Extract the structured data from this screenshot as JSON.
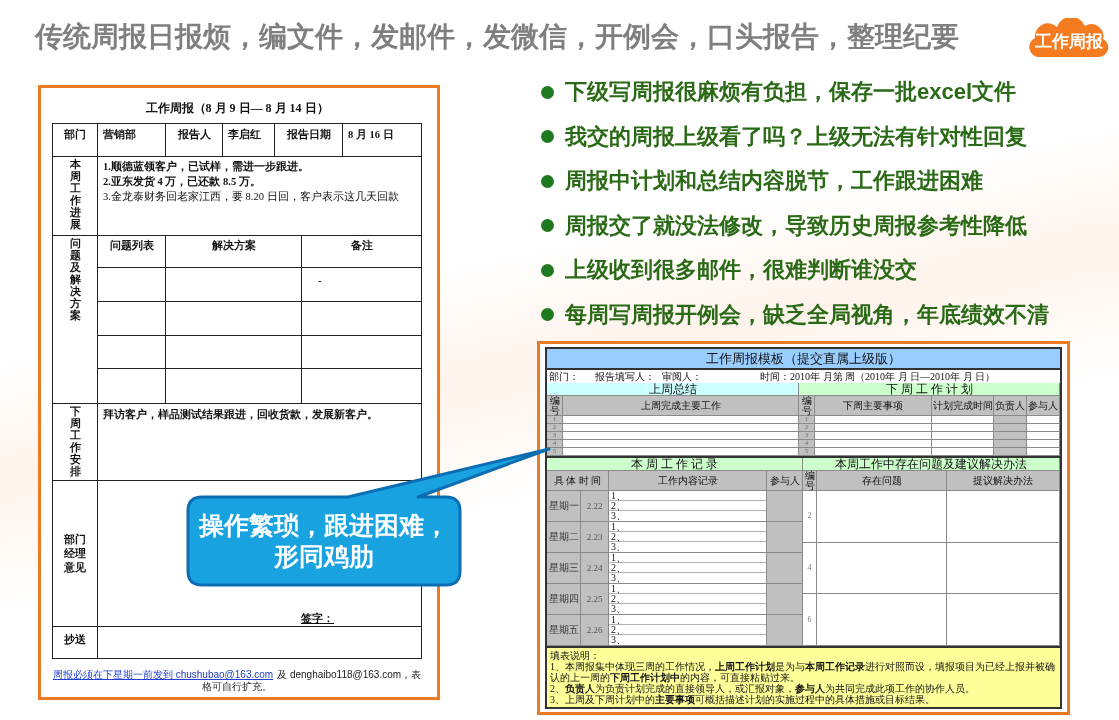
{
  "title": "传统周报日报烦，编文件，发邮件，发微信，开例会，口头报告，整理纪要",
  "logo": {
    "text": "工作周报"
  },
  "report_form": {
    "title": "工作周报（8 月 9 日— 8 月 14 日）",
    "fields": [
      {
        "label": "部门",
        "value": "营销部"
      },
      {
        "label": "报告人",
        "value": "李启红"
      },
      {
        "label": "报告日期",
        "value": "8 月 16 日"
      }
    ],
    "progress": {
      "label": "本周工作进展",
      "lines": [
        {
          "text": "1.顺德蓝领客户，已试样，需进一步跟进。",
          "bold": true
        },
        {
          "text": "2.亚东发货 4 万，已还款 8.5 万。",
          "bold": true
        },
        {
          "text": "3.金龙泰财务回老家江西，要 8.20 日回，客户表示这几天回款",
          "bold": false
        }
      ]
    },
    "issues": {
      "label": "问题及解决方案",
      "columns": [
        "问题列表",
        "解决方案",
        "备注"
      ],
      "rows": [
        {
          "remark": "-"
        },
        {},
        {},
        {}
      ]
    },
    "next_week": {
      "label": "下周工作安排",
      "text": "拜访客户，样品测试结果跟进，回收货款，发展新客户。"
    },
    "manager_opinion": {
      "label": "部门经理意见",
      "signature": "签字："
    },
    "cc": {
      "label": "抄送"
    },
    "footer": {
      "link": "周报必须在下星期一前发到 chushubao@163.com",
      "text": "及 denghaibo118@163.com，表格可自行扩充。"
    }
  },
  "callout": {
    "text": "操作繁琐，跟进困难，形同鸡肋"
  },
  "pain_points": [
    "下级写周报很麻烦有负担，保存一批excel文件",
    "我交的周报上级看了吗？上级无法有针对性回复",
    "周报中计划和总结内容脱节，工作跟进困难",
    "周报交了就没法修改，导致历史周报参考性降低",
    "上级收到很多邮件，很难判断谁没交",
    "每周写周报开例会，缺乏全局视角，年底绩效不清"
  ],
  "template_sheet": {
    "title": "工作周报模板（提交直属上级版）",
    "info": [
      "部门：",
      "报告填写人：",
      "审阅人：",
      "时间：2010年 月第 周（2010年 月 日—2010年 月 日）"
    ],
    "last_week": {
      "heading": "上周总结",
      "columns": [
        "编号",
        "上周完成主要工作"
      ],
      "row_numbers": [
        "1",
        "2",
        "3",
        "4",
        "5"
      ]
    },
    "next_week": {
      "heading": "下 周 工 作 计 划",
      "columns": [
        "编号",
        "下周主要事项",
        "计划完成时间",
        "负责人",
        "参与人"
      ],
      "row_numbers": [
        "1",
        "2",
        "3",
        "4",
        "5"
      ]
    },
    "this_week": {
      "heading": "本 周 工 作 记 录",
      "columns": [
        "具 体 时 间",
        "工作内容记录",
        "参与人"
      ],
      "days": [
        {
          "day": "星期一",
          "date": "2.22",
          "items": [
            "1、",
            "2、",
            "3、"
          ]
        },
        {
          "day": "星期二",
          "date": "2.23",
          "items": [
            "1、",
            "2、",
            "3、"
          ]
        },
        {
          "day": "星期三",
          "date": "2.24",
          "items": [
            "1、",
            "2、",
            "3、"
          ]
        },
        {
          "day": "星期四",
          "date": "2.25",
          "items": [
            "1、",
            "2、",
            "3、"
          ]
        },
        {
          "day": "星期五",
          "date": "2.26",
          "items": [
            "1、",
            "2、",
            "3、"
          ]
        }
      ]
    },
    "issues": {
      "heading": "本周工作中存在问题及建议解决办法",
      "columns": [
        "编号",
        "存在问题",
        "提议解决办法"
      ],
      "numbers": [
        "2",
        "4",
        "6"
      ]
    },
    "notes": {
      "heading": "填表说明：",
      "items": [
        "1、本周报集中体现三周的工作情况，**上周工作计划**是为与**本周工作记录**进行对照而设，填报项目为已经上报并被确认的上一周的**下周工作计划中**的内容，可直接粘贴过来。",
        "2、**负责人**为负责计划完成的直接领导人，或汇报对象，**参与人**为共同完成此项工作的协作人员。",
        "3、上周及下周计划中的**主要事项**可概括描述计划的实施过程中的具体措施或目标结果。"
      ]
    }
  }
}
